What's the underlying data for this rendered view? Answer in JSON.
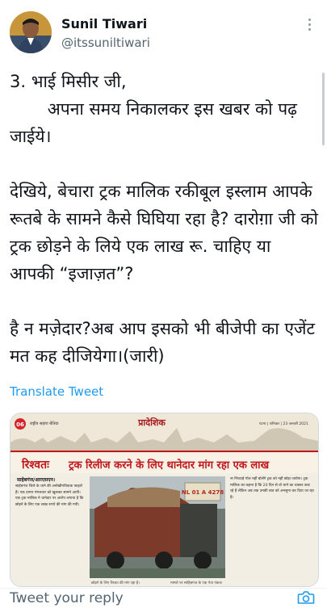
{
  "author": {
    "name": "Sunil Tiwari",
    "handle": "@itssuniltiwari"
  },
  "tweet": {
    "lines": [
      "3. भाई मिसीर जी,",
      "       अपना समय निकालकर इस खबर को पढ़ जाईये।",
      "",
      "देखिये, बेचारा ट्रक मालिक रकीबूल इस्लाम आपके रूतबे के सामने कैसे घिघिया रहा है? दारोग़ा जी को ट्रक छोड़ने के लिये एक लाख रू. चाहिए या आपकी “इजाज़त”?",
      "",
      "है न मज़ेदार?अब आप इसको भी बीजेपी का एजेंट मत कह दीजियेगा।(जारी)"
    ]
  },
  "translate_label": "Translate Tweet",
  "newspaper": {
    "page_number": "06",
    "section": "प्रादेशिक",
    "masthead_left": "राष्ट्रीय सहारा बेतिया",
    "masthead_right": "पटना | शनिवार | 23 जनवरी 2021",
    "headline_kicker": "रिश्वतः",
    "headline": "ट्रक रिलीज करने के लिए थानेदार मांग रहा एक लाख",
    "byline": "साहेबगंज/आरएसएन।",
    "left_column_text": "साहेबगंज जिले के थाने की अनोखीगतिवाक फाइलें हैं। एक दागरा मंगलवार को खुलकर सामने आयी। एक ट्रक मालिक ने थानेदार पर आरोप लगाया है कि छोड़ने के लिए एक लाख रुपये की मांग की गयी।",
    "truck_plate": "NL 01 A 4278",
    "right_column_text": "ना निपटाई गोल नहीं बोलेंगे ट्रक को नहीं छोड़ा जायेगा। ट्रक मालिक का कहना है कि 20 दिन से वो थाने का चक्कर काट रहे हैं लेकिन अब तक उनकी बात को अनसुना कर दिया जा रहा है।",
    "caption_left": "छोड़ने के लिए रिश्वत की मांग रहा है।",
    "caption_right": "मामले पर साहिबगंज के एक नेता पंकज"
  },
  "reply": {
    "placeholder": "Tweet your reply"
  },
  "icons": {
    "more": "more-vertical-icon",
    "camera": "camera-icon"
  },
  "colors": {
    "link_blue": "#1d9bf0",
    "headline_red": "#c0171d",
    "muted_gray": "#536471"
  }
}
